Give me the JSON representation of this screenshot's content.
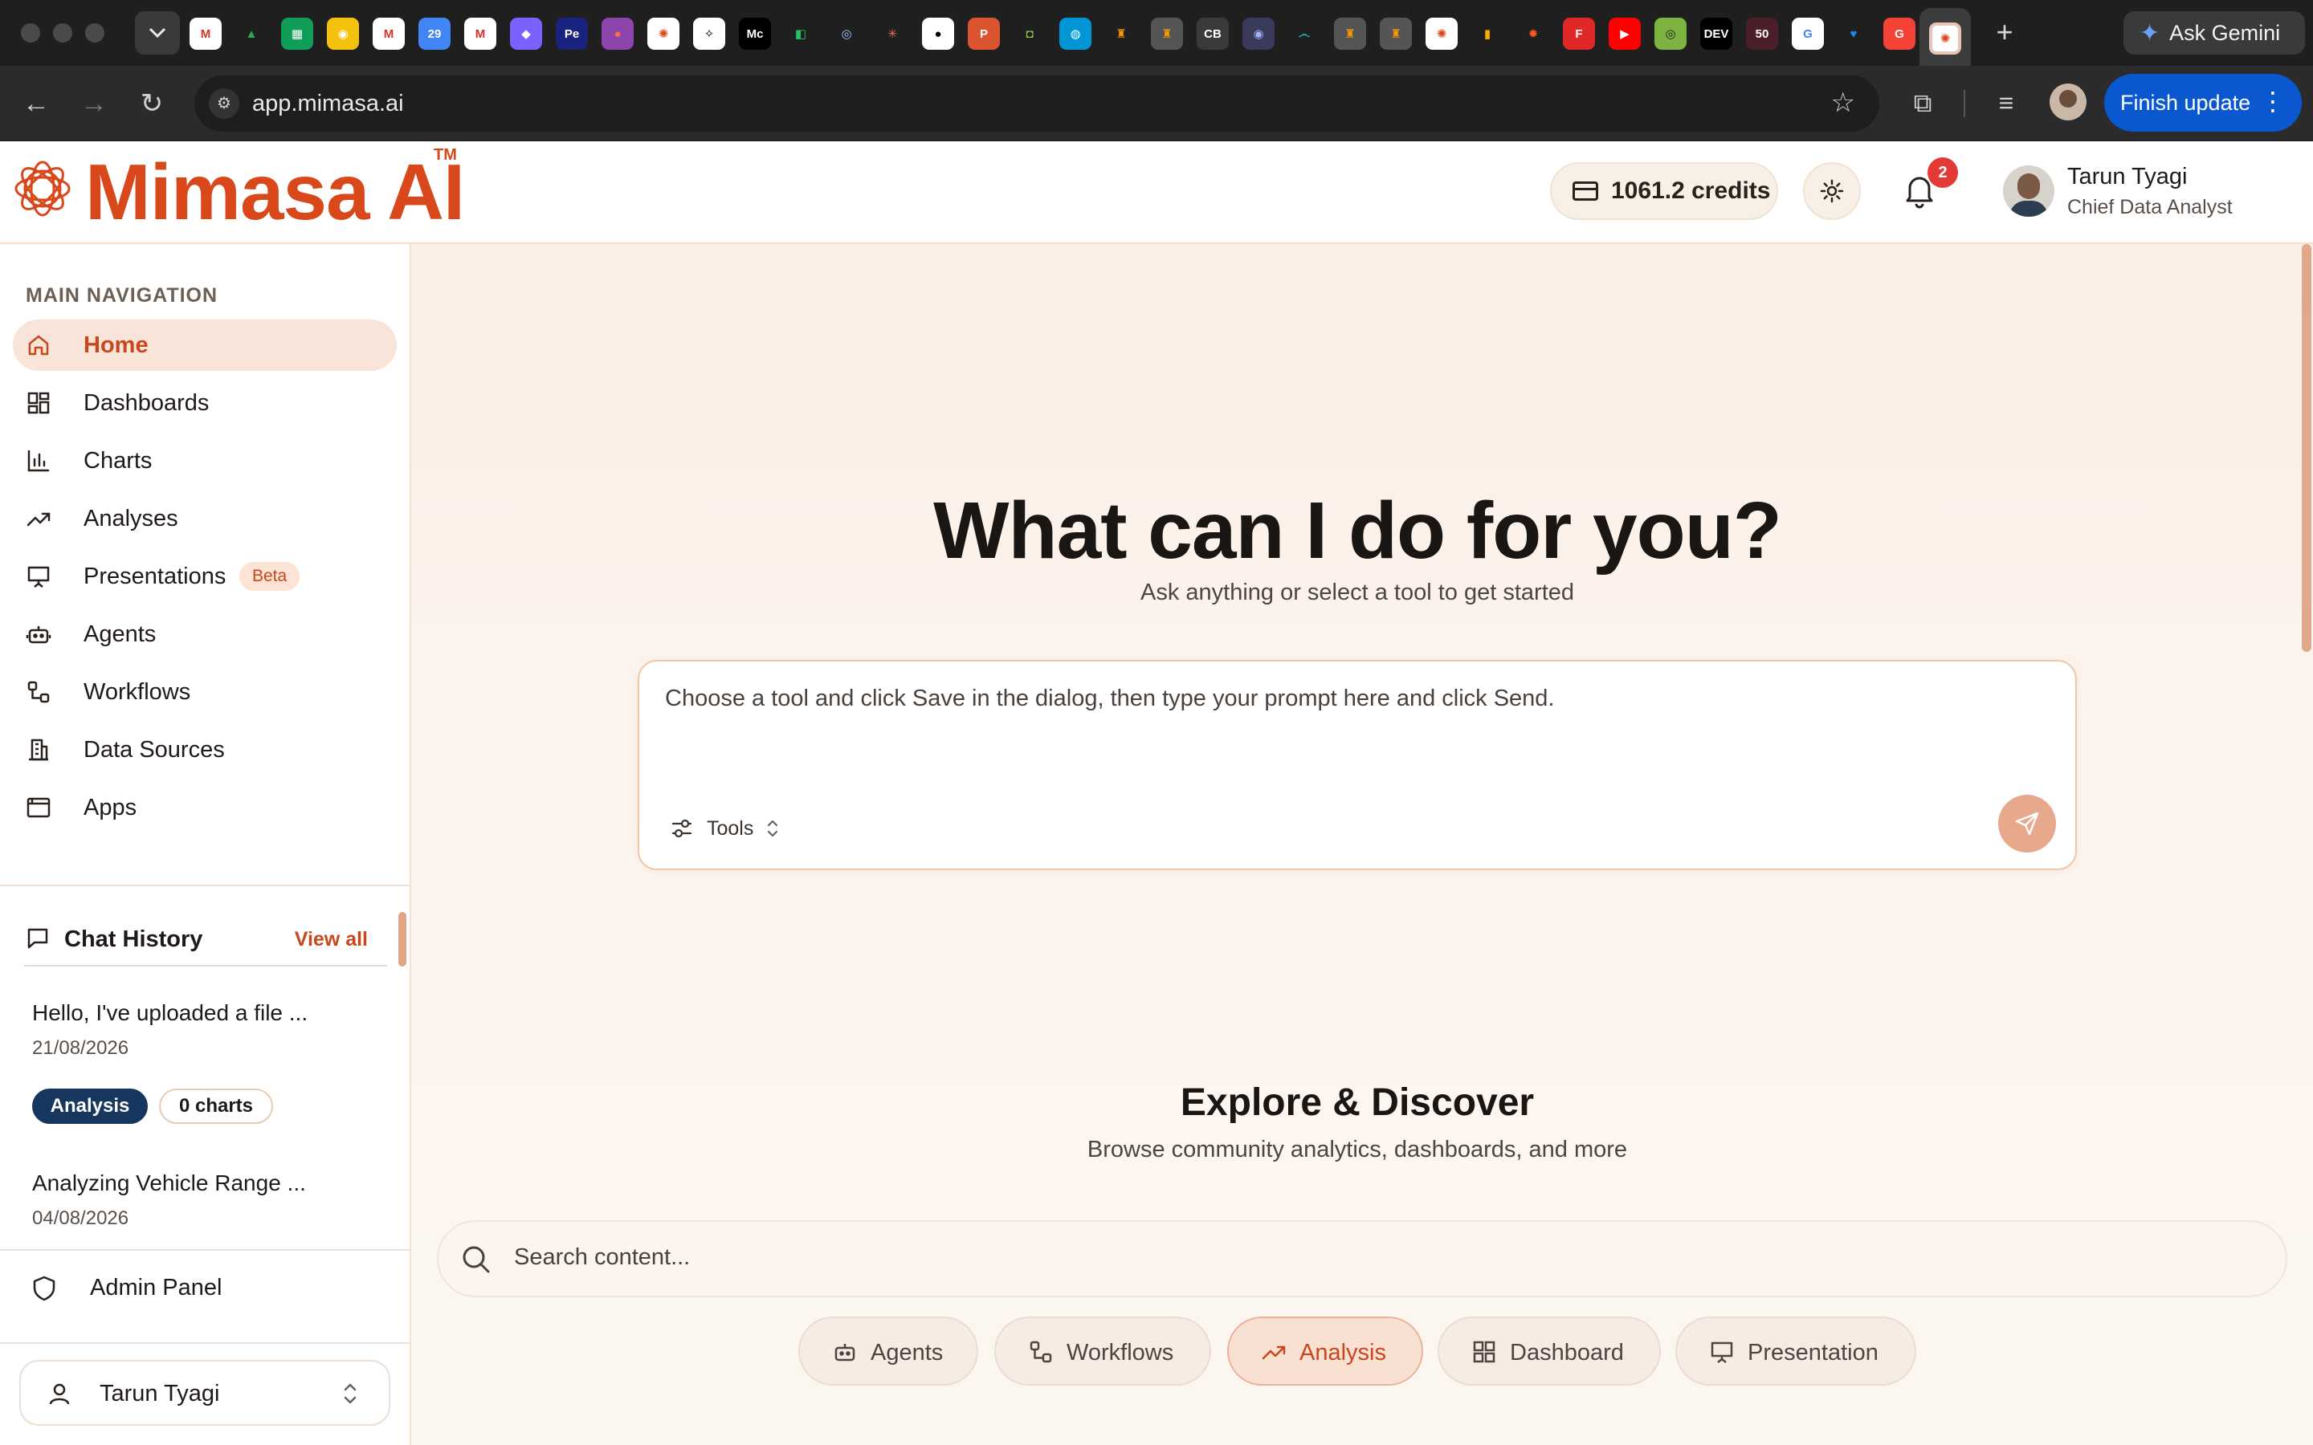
{
  "browser": {
    "url": "app.mimasa.ai",
    "ask_gemini_label": "Ask Gemini",
    "finish_update_label": "Finish update",
    "favicons": [
      {
        "name": "gmail-icon",
        "text": "M",
        "color": "#ffffff",
        "fg": "#d93025"
      },
      {
        "name": "google-drive-icon",
        "text": "▲",
        "color": "#1f1f1f",
        "fg": "#34a853"
      },
      {
        "name": "sheets-icon",
        "text": "▦",
        "color": "#0f9d58",
        "fg": "#ffffff"
      },
      {
        "name": "keep-icon",
        "text": "◉",
        "color": "#f4c20d",
        "fg": "#ffffff"
      },
      {
        "name": "gmail-icon-2",
        "text": "M",
        "color": "#ffffff",
        "fg": "#d93025"
      },
      {
        "name": "calendar-icon",
        "text": "29",
        "color": "#4285f4",
        "fg": "#ffffff"
      },
      {
        "name": "gmail-icon-3",
        "text": "M",
        "color": "#ffffff",
        "fg": "#d93025"
      },
      {
        "name": "comet-icon",
        "text": "◆",
        "color": "#7b61ff",
        "fg": "#ffffff"
      },
      {
        "name": "pe-icon",
        "text": "Pe",
        "color": "#1a237e",
        "fg": "#ffffff"
      },
      {
        "name": "shape-icon",
        "text": "●",
        "color": "#8e44ad",
        "fg": "#ff7043"
      },
      {
        "name": "mimasa-tab-icon",
        "text": "✺",
        "color": "#ffffff",
        "fg": "#d9481a"
      },
      {
        "name": "openai-icon",
        "text": "✧",
        "color": "#ffffff",
        "fg": "#000000"
      },
      {
        "name": "medium-icon",
        "text": "Mc",
        "color": "#000000",
        "fg": "#ffffff"
      },
      {
        "name": "notion-icon",
        "text": "◧",
        "color": "#1f1f1f",
        "fg": "#22c55e"
      },
      {
        "name": "copilot-icon",
        "text": "◎",
        "color": "#1f1f1f",
        "fg": "#9fc5ff"
      },
      {
        "name": "claude-icon",
        "text": "✳",
        "color": "#1f1f1f",
        "fg": "#d97757"
      },
      {
        "name": "github-icon",
        "text": "●",
        "color": "#ffffff",
        "fg": "#000000"
      },
      {
        "name": "producthunt-icon",
        "text": "P",
        "color": "#da552f",
        "fg": "#ffffff"
      },
      {
        "name": "app-icon",
        "text": "◘",
        "color": "#1f1f1f",
        "fg": "#8bc34a"
      },
      {
        "name": "globe-icon",
        "text": "◍",
        "color": "#0096d6",
        "fg": "#ffffff"
      },
      {
        "name": "emblem-icon",
        "text": "♜",
        "color": "#1f1f1f",
        "fg": "#ff9800"
      },
      {
        "name": "emblem-icon-2",
        "text": "♜",
        "color": "#555555",
        "fg": "#ff9800"
      },
      {
        "name": "crunchbase-icon",
        "text": "CB",
        "color": "#3a3a3a",
        "fg": "#ffffff"
      },
      {
        "name": "circle-icon",
        "text": "◉",
        "color": "#3a3a5a",
        "fg": "#9fb3ff"
      },
      {
        "name": "perplexity-icon",
        "text": "෴",
        "color": "#1f1f1f",
        "fg": "#20b8cd"
      },
      {
        "name": "emblem-icon-3",
        "text": "♜",
        "color": "#555555",
        "fg": "#ff9800"
      },
      {
        "name": "emblem-icon-4",
        "text": "♜",
        "color": "#555555",
        "fg": "#ff9800"
      },
      {
        "name": "mimasa-tab-icon-2",
        "text": "✺",
        "color": "#ffffff",
        "fg": "#d9481a"
      },
      {
        "name": "analytics-icon",
        "text": "▮",
        "color": "#1f1f1f",
        "fg": "#f9ab00"
      },
      {
        "name": "orange-icon",
        "text": "✹",
        "color": "#1f1f1f",
        "fg": "#ff5722"
      },
      {
        "name": "flipboard-icon",
        "text": "F",
        "color": "#e12828",
        "fg": "#ffffff"
      },
      {
        "name": "youtube-icon",
        "text": "▶",
        "color": "#ff0000",
        "fg": "#ffffff"
      },
      {
        "name": "green-app-icon",
        "text": "◎",
        "color": "#7cb342",
        "fg": "#1f1f1f"
      },
      {
        "name": "dev-icon",
        "text": "DEV",
        "color": "#000000",
        "fg": "#ffffff"
      },
      {
        "name": "fifty-icon",
        "text": "50",
        "color": "#4a1f2a",
        "fg": "#ffffff"
      },
      {
        "name": "google-icon",
        "text": "G",
        "color": "#ffffff",
        "fg": "#4285f4"
      },
      {
        "name": "heart-icon",
        "text": "♥",
        "color": "#1f1f1f",
        "fg": "#1e88e5"
      },
      {
        "name": "grammarly-icon",
        "text": "G",
        "color": "#f44336",
        "fg": "#ffffff"
      }
    ]
  },
  "header": {
    "logo_text": "Mimasa AI",
    "logo_tm": "TM",
    "credits": "1061.2 credits",
    "notification_count": "2",
    "user_name": "Tarun Tyagi",
    "user_role": "Chief Data Analyst"
  },
  "sidebar": {
    "heading": "MAIN NAVIGATION",
    "items": [
      {
        "label": "Home",
        "icon": "home-icon",
        "active": true
      },
      {
        "label": "Dashboards",
        "icon": "dashboards-icon"
      },
      {
        "label": "Charts",
        "icon": "bar-chart-icon"
      },
      {
        "label": "Analyses",
        "icon": "trending-up-icon"
      },
      {
        "label": "Presentations",
        "icon": "presentation-icon",
        "badge": "Beta"
      },
      {
        "label": "Agents",
        "icon": "bot-icon"
      },
      {
        "label": "Workflows",
        "icon": "workflow-icon"
      },
      {
        "label": "Data Sources",
        "icon": "database-icon"
      },
      {
        "label": "Apps",
        "icon": "app-window-icon"
      }
    ],
    "chat_history": {
      "title": "Chat History",
      "view_all": "View all",
      "items": [
        {
          "title": "Hello, I've uploaded a file ...",
          "date": "21/08/2026",
          "tags": [
            "Analysis",
            "0 charts"
          ]
        },
        {
          "title": "Analyzing Vehicle Range ...",
          "date": "04/08/2026"
        }
      ]
    },
    "admin_label": "Admin Panel",
    "user_switch_label": "Tarun Tyagi"
  },
  "main": {
    "hero_title": "What can I do for you?",
    "hero_subtitle": "Ask anything or select a tool to get started",
    "prompt_placeholder": "Choose a tool and click Save in the dialog, then type your prompt here and click Send.",
    "tools_label": "Tools",
    "explore_title": "Explore & Discover",
    "explore_subtitle": "Browse community analytics, dashboards, and more",
    "search_placeholder": "Search content...",
    "filters": [
      {
        "label": "Agents",
        "icon": "bot-icon"
      },
      {
        "label": "Workflows",
        "icon": "workflow-icon"
      },
      {
        "label": "Analysis",
        "icon": "trending-up-icon",
        "active": true
      },
      {
        "label": "Dashboard",
        "icon": "dashboards-icon"
      },
      {
        "label": "Presentation",
        "icon": "presentation-icon"
      }
    ]
  },
  "colors": {
    "brand": "#d9481a",
    "accent_bg": "#f8e4d8",
    "tag_dark": "#17375e",
    "send_button": "#e7a88c"
  }
}
